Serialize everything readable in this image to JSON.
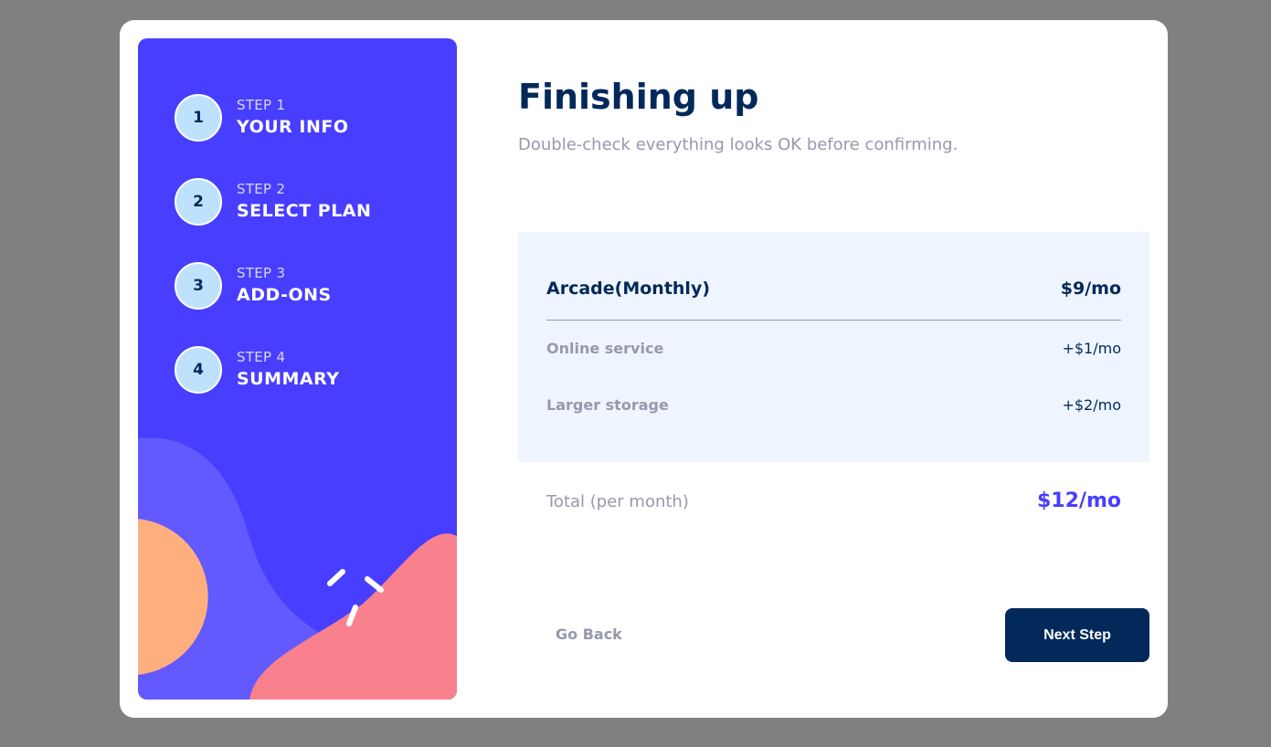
{
  "sidebar": {
    "steps": [
      {
        "number": "1",
        "label": "STEP 1",
        "title": "YOUR INFO"
      },
      {
        "number": "2",
        "label": "STEP 2",
        "title": "SELECT PLAN"
      },
      {
        "number": "3",
        "label": "STEP 3",
        "title": "ADD-ONS"
      },
      {
        "number": "4",
        "label": "STEP 4",
        "title": "SUMMARY"
      }
    ]
  },
  "main": {
    "title": "Finishing up",
    "subtitle": "Double-check everything looks OK before confirming.",
    "summary": {
      "plan_name": "Arcade(Monthly)",
      "plan_price": "$9/mo",
      "addons": [
        {
          "name": "Online service",
          "price": "+$1/mo"
        },
        {
          "name": "Larger storage",
          "price": "+$2/mo"
        }
      ]
    },
    "total_label": "Total (per month)",
    "total_price": "$12/mo",
    "go_back_label": "Go Back",
    "next_label": "Next Step"
  },
  "colors": {
    "sidebar": "#483eff",
    "step_circle": "#bee2fd",
    "marine_blue": "#02295a",
    "purplish_blue": "#483eff",
    "cool_gray": "#9699ab",
    "summary_bg": "#eef5ff",
    "page_bg": "#808080",
    "orange_shape": "#ffaf7e",
    "pink_shape": "#f9818e",
    "light_purple_shape": "#6259ff"
  }
}
